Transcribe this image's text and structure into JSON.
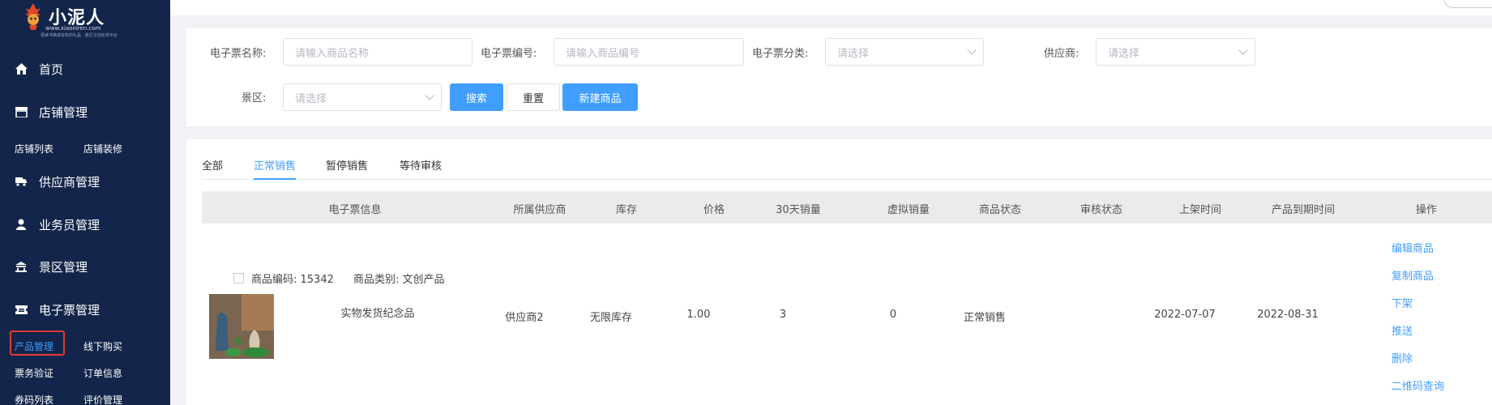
{
  "brand": {
    "name": "小泥人",
    "url": "www.xiaoniren.com",
    "slogan": "把读书换成有料的礼品 · 景区文创在线平台"
  },
  "sidebar": {
    "menu": [
      {
        "label": "首页",
        "icon": "home-icon"
      },
      {
        "label": "店铺管理",
        "icon": "store-icon"
      },
      {
        "label": "供应商管理",
        "icon": "truck-icon"
      },
      {
        "label": "业务员管理",
        "icon": "user-icon"
      },
      {
        "label": "景区管理",
        "icon": "scenic-icon"
      },
      {
        "label": "电子票管理",
        "icon": "ticket-icon"
      }
    ],
    "store_subs": [
      "店铺列表",
      "店铺装修"
    ],
    "ticket_subs": [
      "产品管理",
      "线下购买",
      "票务验证",
      "订单信息",
      "券码列表",
      "评价管理"
    ]
  },
  "topbar": {
    "right_text": "··· ··· ·  ··· ·"
  },
  "filter": {
    "name_label": "电子票名称:",
    "name_placeholder": "请输入商品名称",
    "code_label": "电子票编号:",
    "code_placeholder": "请输入商品编号",
    "category_label": "电子票分类:",
    "category_placeholder": "请选择",
    "supplier_label": "供应商:",
    "supplier_placeholder": "请选择",
    "scenic_label": "景区:",
    "scenic_placeholder": "请选择",
    "search_button": "搜索",
    "reset_button": "重置",
    "new_button": "新建商品"
  },
  "tabs": [
    "全部",
    "正常销售",
    "暂停销售",
    "等待审核"
  ],
  "active_tab": "正常销售",
  "table": {
    "columns": [
      "电子票信息",
      "所属供应商",
      "库存",
      "价格",
      "30天销量",
      "虚拟销量",
      "商品状态",
      "审核状态",
      "上架时间",
      "产品到期时间",
      "操作"
    ],
    "rows": [
      {
        "code_label": "商品编码: 15342",
        "category_label": "商品类别: 文创产品",
        "name": "实物发货纪念品",
        "supplier": "供应商2",
        "stock": "无限库存",
        "price": "1.00",
        "sales_30d": "3",
        "virtual_sales": "0",
        "status": "正常销售",
        "review_status": "",
        "listed_date": "2022-07-07",
        "expire_date": "2022-08-31",
        "actions": [
          "编辑商品",
          "复制商品",
          "下架",
          "推送",
          "删除",
          "二维码查询"
        ]
      }
    ]
  },
  "colors": {
    "sidebar_bg": "#13254a",
    "accent": "#409eff",
    "highlight_border": "#e53935"
  }
}
